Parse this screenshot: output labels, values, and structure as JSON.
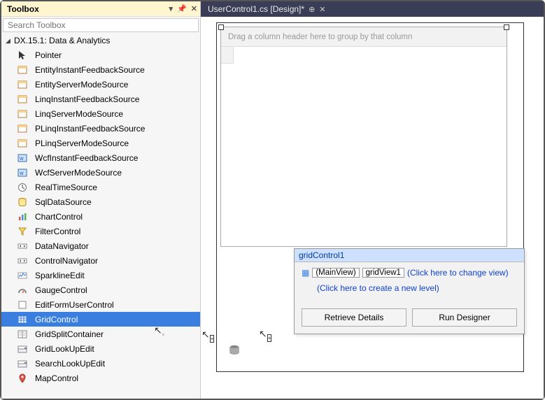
{
  "toolbox": {
    "title": "Toolbox",
    "searchPlaceholder": "Search Toolbox",
    "category": "DX.15.1: Data & Analytics",
    "items": [
      {
        "icon": "pointer",
        "label": "Pointer"
      },
      {
        "icon": "ds",
        "label": "EntityInstantFeedbackSource"
      },
      {
        "icon": "ds",
        "label": "EntityServerModeSource"
      },
      {
        "icon": "ds",
        "label": "LinqInstantFeedbackSource"
      },
      {
        "icon": "ds",
        "label": "LinqServerModeSource"
      },
      {
        "icon": "ds",
        "label": "PLinqInstantFeedbackSource"
      },
      {
        "icon": "ds",
        "label": "PLinqServerModeSource"
      },
      {
        "icon": "wcf",
        "label": "WcfInstantFeedbackSource"
      },
      {
        "icon": "wcf",
        "label": "WcfServerModeSource"
      },
      {
        "icon": "rt",
        "label": "RealTimeSource"
      },
      {
        "icon": "sql",
        "label": "SqlDataSource"
      },
      {
        "icon": "chart",
        "label": "ChartControl"
      },
      {
        "icon": "filter",
        "label": "FilterControl"
      },
      {
        "icon": "nav",
        "label": "DataNavigator"
      },
      {
        "icon": "nav",
        "label": "ControlNavigator"
      },
      {
        "icon": "spark",
        "label": "SparklineEdit"
      },
      {
        "icon": "gauge",
        "label": "GaugeControl"
      },
      {
        "icon": "form",
        "label": "EditFormUserControl"
      },
      {
        "icon": "grid",
        "label": "GridControl",
        "selected": true
      },
      {
        "icon": "split",
        "label": "GridSplitContainer"
      },
      {
        "icon": "lookup",
        "label": "GridLookUpEdit"
      },
      {
        "icon": "lookup",
        "label": "SearchLookUpEdit"
      },
      {
        "icon": "map",
        "label": "MapControl"
      }
    ]
  },
  "tab": {
    "label": "UserControl1.cs [Design]*"
  },
  "grid": {
    "groupPanelText": "Drag a column header here to group by that column"
  },
  "popup": {
    "title": "gridControl1",
    "mainViewLabel": "(MainView)",
    "viewName": "gridView1",
    "changeViewLink": "(Click here to change view)",
    "createLevelLink": "(Click here to create a new level)",
    "retrieveDetails": "Retrieve Details",
    "runDesigner": "Run Designer"
  }
}
